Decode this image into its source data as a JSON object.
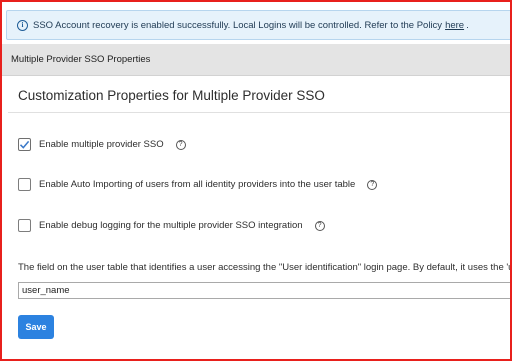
{
  "notice": {
    "icon": "info-icon",
    "text": "SSO Account recovery is enabled successfully. Local Logins will be controlled. Refer to the Policy",
    "link": "here",
    "suffix": "."
  },
  "header": {
    "title": "Multiple Provider SSO Properties"
  },
  "panel": {
    "title": "Customization Properties for Multiple Provider SSO"
  },
  "options": [
    {
      "label": "Enable multiple provider SSO",
      "checked": true
    },
    {
      "label": "Enable Auto Importing of users from all identity providers into the user table",
      "checked": false
    },
    {
      "label": "Enable debug logging for the multiple provider SSO integration",
      "checked": false
    }
  ],
  "help_glyph": "?",
  "user_field": {
    "description": "The field on the user table that identifies a user accessing the \"User identification\" login page. By default, it uses the 'u",
    "value": "user_name"
  },
  "actions": {
    "save_label": "Save"
  },
  "colors": {
    "accent": "#2c82e0",
    "notice_bg": "#e6f2fb",
    "header_bg": "#e4e4e4",
    "frame": "#e8201c"
  }
}
